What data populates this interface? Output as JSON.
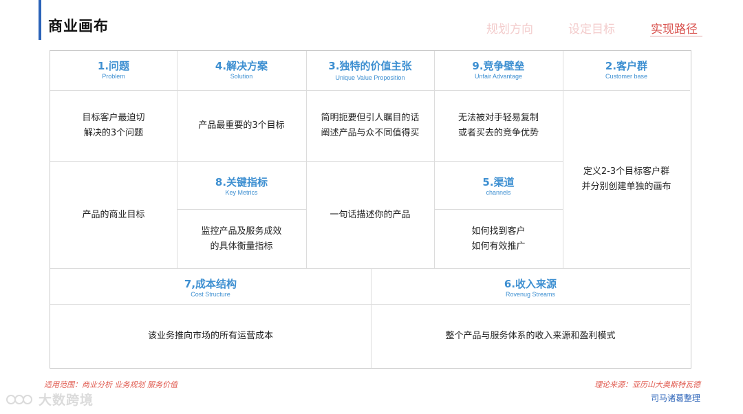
{
  "page": {
    "title": "商业画布",
    "nav": [
      "规划方向",
      "设定目标",
      "实现路径"
    ],
    "active_nav_color": "#d9534f",
    "accent_color": "#3d8fd1"
  },
  "blocks": {
    "problem": {
      "title": "1.问题",
      "subtitle": "Problem",
      "text1": "目标客户最迫切\n解决的3个问题",
      "text2": "产品的商业目标"
    },
    "solution": {
      "title": "4.解决方案",
      "subtitle": "Solution",
      "text": "产品最重要的3个目标"
    },
    "uvp": {
      "title": "3.独特的价值主张",
      "subtitle": "Unique Value Proposition",
      "text1": "简明扼要但引人瞩目的话\n阐述产品与众不同值得买",
      "text2": "一句话描述你的产品"
    },
    "advantage": {
      "title": "9.竞争壁垒",
      "subtitle": "Unfair Advantage",
      "text": "无法被对手轻易复制\n或者买去的竞争优势"
    },
    "segments": {
      "title": "2.客户群",
      "subtitle": "Customer base",
      "text": "定义2-3个目标客户群\n并分别创建单独的画布"
    },
    "metrics": {
      "title": "8.关键指标",
      "subtitle": "Key Metrics",
      "text": "监控产品及服务成效\n的具体衡量指标"
    },
    "channels": {
      "title": "5.渠道",
      "subtitle": "channels",
      "text": "如何找到客户\n如何有效推广"
    },
    "cost": {
      "title": "7,成本结构",
      "subtitle": "Cost Structure",
      "text": "该业务推向市场的所有运营成本"
    },
    "revenue": {
      "title": "6.收入来源",
      "subtitle": "Rovenug  Streams",
      "text": "整个产品与服务体系的收入来源和盈利模式"
    }
  },
  "footer": {
    "scope": "适用范围：商业分析 业务规划 服务价值",
    "source": "理论来源：亚历山大奥斯特瓦德",
    "editor": "司马诸葛整理",
    "watermark": "大数跨境"
  }
}
